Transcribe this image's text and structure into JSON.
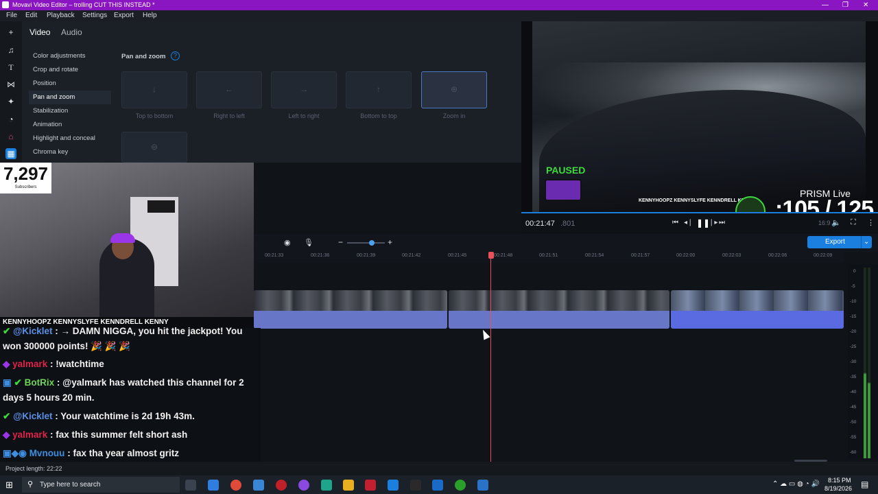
{
  "window": {
    "title": "Movavi Video Editor – trolling CUT THIS INSTEAD *"
  },
  "menu": [
    "File",
    "Edit",
    "Playback",
    "Settings",
    "Export",
    "Help"
  ],
  "editor_tabs": {
    "video": "Video",
    "audio": "Audio"
  },
  "categories": [
    "Color adjustments",
    "Crop and rotate",
    "Position",
    "Pan and zoom",
    "Stabilization",
    "Animation",
    "Highlight and conceal",
    "Chroma key"
  ],
  "pan_zoom": {
    "heading": "Pan and zoom",
    "presets": [
      "Top to bottom",
      "Right to left",
      "Left to right",
      "Bottom to top",
      "Zoom in"
    ]
  },
  "overlay": {
    "subscribers_count": "7,297",
    "subscribers_label": "Subscribers",
    "paused": "PAUSED",
    "prism": "PRISM Live",
    "goal": ":105 / 125",
    "socials": "KENNYHOOPZ  KENNYSLYFE  KENNDRELL  KENNY"
  },
  "chat": [
    {
      "user": "@Kicklet",
      "text": ": → DAMN NIGGA, you hit the jackpot! You",
      "user_color": "#5b8fe6"
    },
    {
      "user": "",
      "text": "won 300000 points! 🎉 🎉 🎉",
      "user_color": "#ffffff"
    },
    {
      "user": "yalmark",
      "text": ": !watchtime",
      "user_color": "#e0234a"
    },
    {
      "user": "BotRix",
      "text": ": @yalmark has watched this channel for 2",
      "user_color": "#6ed35a"
    },
    {
      "user": "",
      "text": "days 5 hours 20 min.",
      "user_color": "#ffffff"
    },
    {
      "user": "@Kicklet",
      "text": ": Your watchtime is 2d 19h 43m.",
      "user_color": "#5b8fe6"
    },
    {
      "user": "yalmark",
      "text": ": fax this summer felt short ash",
      "user_color": "#e0234a"
    },
    {
      "user": "Mvnouu",
      "text": ": fax tha year almost gritz",
      "user_color": "#3d8ee0"
    }
  ],
  "player": {
    "time": "00:21:47",
    "frames": ".801",
    "aspect": "16:9"
  },
  "export_label": "Export",
  "ruler": [
    "00:21:33",
    "00:21:36",
    "00:21:39",
    "00:21:42",
    "00:21:45",
    "00:21:48",
    "00:21:51",
    "00:21:54",
    "00:21:57",
    "00:22:00",
    "00:22:03",
    "00:22:06",
    "00:22:09"
  ],
  "volume_ticks": [
    "0",
    "-5",
    "-10",
    "-15",
    "-20",
    "-25",
    "-30",
    "-35",
    "-40",
    "-45",
    "-50",
    "-55",
    "-60"
  ],
  "status": {
    "project_length": "Project length: 22:22"
  },
  "taskbar": {
    "search_placeholder": "Type here to search",
    "time": "8:15 PM",
    "date": "8/19/2026"
  },
  "colors": {
    "accent": "#1b7fe0",
    "titlebar": "#8a16c2",
    "playhead": "#e8505a",
    "paused": "#3ddc3d"
  }
}
